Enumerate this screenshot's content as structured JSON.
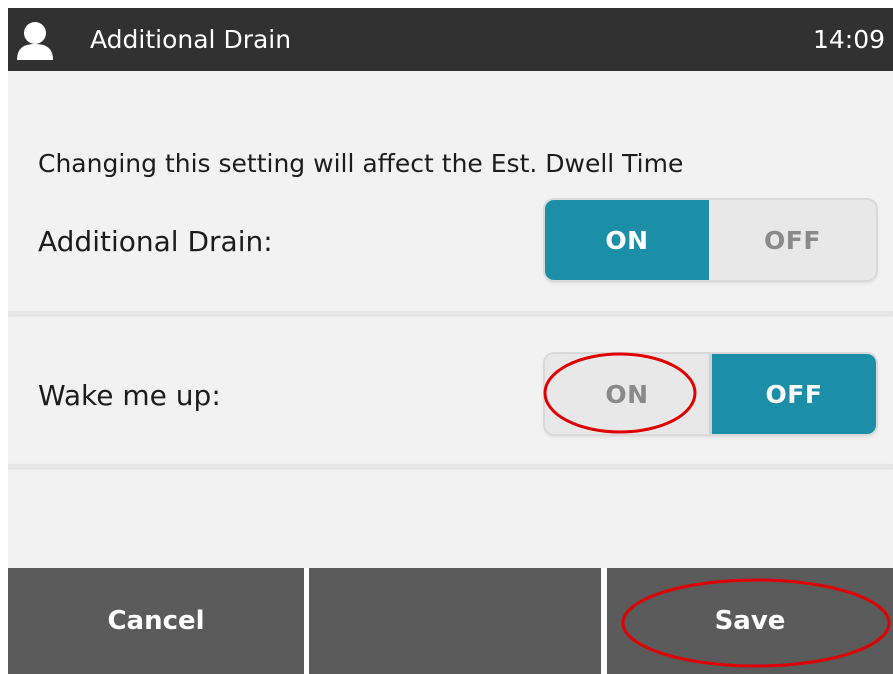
{
  "header": {
    "title": "Additional Drain",
    "time": "14:09",
    "icon": "user-icon",
    "background": "#313131"
  },
  "notice": "Changing this setting will affect the Est. Dwell Time",
  "settings": [
    {
      "label": "Additional Drain:",
      "on_label": "ON",
      "off_label": "OFF",
      "selected": "ON"
    },
    {
      "label": "Wake me up:",
      "on_label": "ON",
      "off_label": "OFF",
      "selected": "OFF"
    }
  ],
  "footer": {
    "cancel_label": "Cancel",
    "middle_label": "",
    "save_label": "Save"
  },
  "colors": {
    "accent": "#1b8fa8",
    "footer_button": "#5b5b5b",
    "annotation": "#e00000"
  },
  "annotations": [
    "wake-me-up-on-option",
    "save-button"
  ]
}
